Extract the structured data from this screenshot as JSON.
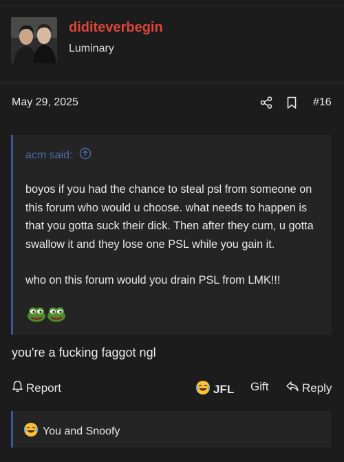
{
  "post": {
    "author": "diditeverbegin",
    "author_title": "Luminary",
    "date": "May 29, 2025",
    "post_number": "#16",
    "quote": {
      "source": "acm said:",
      "paragraph1": "boyos if you had the chance to steal psl from someone on this forum who would u choose. what needs to happen is that you gotta suck their dick. Then after they cum, u gotta swallow it and they lose one PSL while you gain it.",
      "paragraph2": "who on this forum would you drain PSL from LMK!!!",
      "emojis": [
        "pepe-icon",
        "pepe-icon"
      ]
    },
    "reply": "you're a fucking faggot ngl"
  },
  "actions": {
    "report": "Report",
    "jfl": "JFL",
    "gift": "Gift",
    "reply": "Reply"
  },
  "reactions": {
    "summary": "You and Snoofy",
    "icon": "laughing-crying-emoji"
  },
  "colors": {
    "username": "#e0453a",
    "quote_border": "#3b5998",
    "quote_source": "#4a6ca8",
    "background": "#1c1c1c"
  }
}
